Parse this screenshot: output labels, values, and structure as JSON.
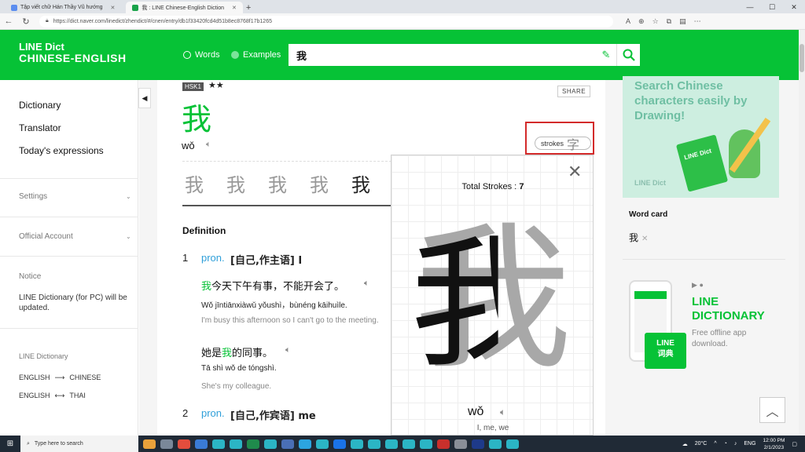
{
  "browser": {
    "tabs": [
      {
        "label": "Tập viết chữ Hán Thầy Vũ hướng",
        "active": false
      },
      {
        "label": "我 : LINE Chinese-English Diction",
        "active": true
      }
    ],
    "url": "https://dict.naver.com/linedict/zhendict/#/cnen/entry/db1f33420fcd4d51b8ec8768f17b1265"
  },
  "header": {
    "logo_line1": "LINE Dict",
    "logo_line2": "CHINESE-ENGLISH",
    "radio_words": "Words",
    "radio_examples": "Examples",
    "search_value": "我"
  },
  "sidebar": {
    "items": [
      "Dictionary",
      "Translator",
      "Today's expressions"
    ],
    "settings": "Settings",
    "official_account": "Official Account",
    "notice_title": "Notice",
    "notice_text": "LINE Dictionary (for PC) will be updated.",
    "line_dictionary": "LINE Dictionary",
    "lang1_from": "ENGLISH",
    "lang1_arrow": "⟶",
    "lang1_to": "CHINESE",
    "lang2_from": "ENGLISH",
    "lang2_arrow": "⟷",
    "lang2_to": "THAI"
  },
  "entry": {
    "hsk": "HSK1",
    "stars": "★★",
    "share": "SHARE",
    "headword": "我",
    "pinyin": "wǒ",
    "strokes_label": "strokes",
    "strokes_char": "字",
    "stroke_chars": [
      "我",
      "我",
      "我",
      "我",
      "我"
    ],
    "definition_title": "Definition",
    "senses": [
      {
        "num": "1",
        "pos": "pron.",
        "gloss": "[自己,作主语] I",
        "example_before": "",
        "example_highlight": "我",
        "example_after": "今天下午有事，不能开会了。",
        "example_pinyin": "Wǒ jīntiānxiàwǔ yǒushì，bùnéng kāihuìle.",
        "example_en": "I'm busy this afternoon so I can't go to the meeting."
      },
      {
        "example_before": "她是",
        "example_highlight": "我",
        "example_after": "的同事。",
        "example_pinyin": "Tā shì wǒ de tóngshì.",
        "example_en": "She's my colleague."
      },
      {
        "num": "2",
        "pos": "pron.",
        "gloss": "[自己,作宾语] me"
      }
    ]
  },
  "stroke_popup": {
    "total_label": "Total Strokes :",
    "total_value": "7",
    "character": "我",
    "pinyin": "wǒ",
    "meaning": "I, me, we"
  },
  "right": {
    "ad_text": "Search Chinese characters easily by Drawing!",
    "ad_brand": "LINE Dict",
    "ad_book": "LINE Dict",
    "word_card_title": "Word card",
    "word_card_item": "我",
    "app_title": "LINE DICTIONARY",
    "app_badge_line1": "LINE",
    "app_badge_line2": "词典",
    "app_sub": "Free offline app download."
  },
  "taskbar": {
    "search_placeholder": "Type here to search",
    "temperature": "20°C",
    "language": "ENG",
    "time": "12:00 PM",
    "date": "2/1/2023"
  },
  "colors": {
    "brand_green": "#06c236",
    "pos_blue": "#2f9fd9",
    "highlight_red": "#d32b2b"
  }
}
